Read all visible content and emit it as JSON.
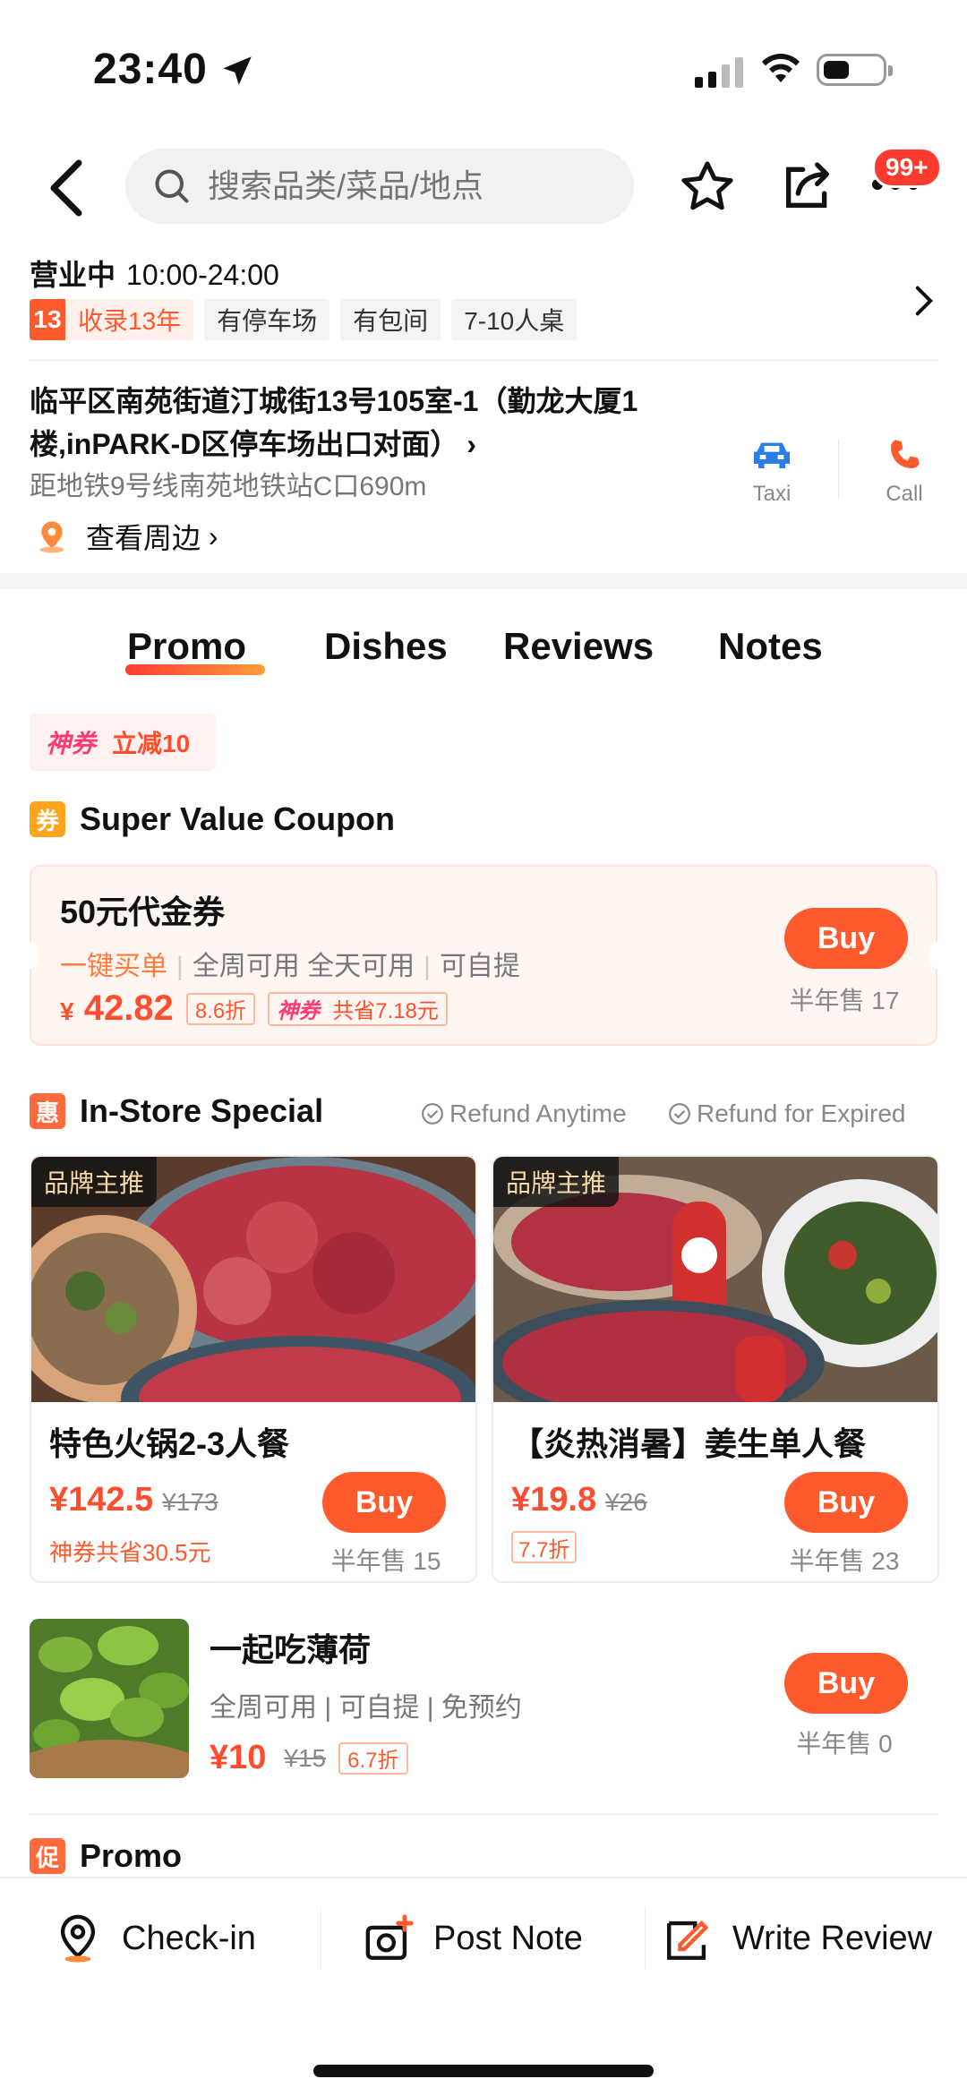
{
  "status_bar": {
    "time": "23:40"
  },
  "search": {
    "placeholder": "搜索品类/菜品/地点"
  },
  "header": {
    "notification_badge": "99+"
  },
  "store": {
    "status": "营业中",
    "hours": "10:00-24:00",
    "years_num": "13",
    "years_label": "收录13年",
    "tags": [
      "有停车场",
      "有包间",
      "7-10人桌"
    ],
    "address": "临平区南苑街道汀城街13号105室-1（勤龙大厦1楼,inPARK-D区停车场出口对面）",
    "subway": "距地铁9号线南苑地铁站C口690m",
    "nearby": "查看周边",
    "taxi_label": "Taxi",
    "call_label": "Call"
  },
  "tabs": [
    "Promo",
    "Dishes",
    "Reviews",
    "Notes"
  ],
  "shen_tag": {
    "brand": "神券",
    "text": "立减10"
  },
  "coupon_section": {
    "icon_char": "券",
    "title": "Super Value Coupon",
    "card": {
      "title": "50元代金券",
      "feature_hl": "一键买单",
      "feature_2": "全周可用 全天可用",
      "feature_3": "可自提",
      "currency": "¥",
      "price": "42.82",
      "discount": "8.6折",
      "shen_brand": "神券",
      "save_text": "共省7.18元",
      "buy_label": "Buy",
      "sold": "半年售 17"
    }
  },
  "instore_section": {
    "icon_char": "惠",
    "title": "In-Store Special",
    "guarantee_1": "Refund Anytime",
    "guarantee_2": "Refund for Expired",
    "products": [
      {
        "brand_tag": "品牌主推",
        "title": "特色火锅2-3人餐",
        "price": "¥142.5",
        "orig": "¥173",
        "save": "神券共省30.5元",
        "buy_label": "Buy",
        "sold": "半年售 15"
      },
      {
        "brand_tag": "品牌主推",
        "title": "【炎热消暑】姜生单人餐",
        "price": "¥19.8",
        "orig": "¥26",
        "discount": "7.7折",
        "buy_label": "Buy",
        "sold": "半年售 23"
      }
    ],
    "mint": {
      "title": "一起吃薄荷",
      "features": "全周可用 | 可自提 | 免预约",
      "price": "¥10",
      "orig": "¥15",
      "discount": "6.7折",
      "buy_label": "Buy",
      "sold": "半年售 0"
    }
  },
  "promo_section": {
    "icon_char": "促",
    "title": "Promo"
  },
  "bottom_bar": {
    "checkin": "Check-in",
    "post_note": "Post Note",
    "write_review": "Write Review"
  },
  "colors": {
    "accent": "#ff5a2d",
    "price": "#ff4d2d",
    "taxi": "#2b7de9"
  }
}
